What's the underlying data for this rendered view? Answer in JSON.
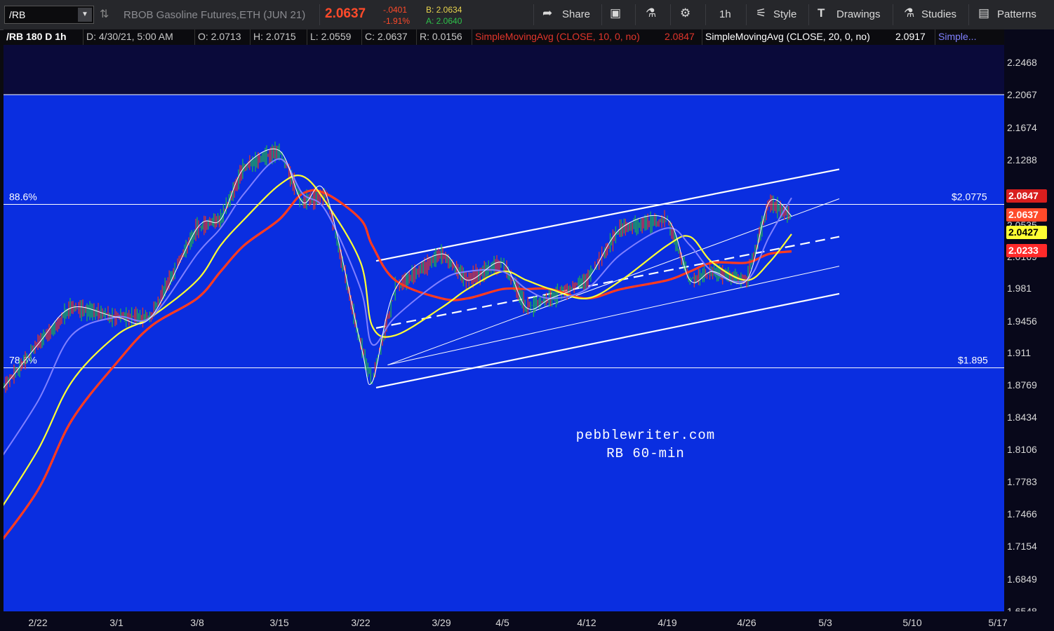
{
  "toolbar": {
    "symbol": "/RB",
    "description": "RBOB Gasoline Futures,ETH (JUN 21)",
    "last": "2.0637",
    "net_change": "-.0401",
    "pct_change": "-1.91%",
    "bid": "B: 2.0634",
    "ask": "A: 2.0640",
    "share_label": "Share",
    "timeframe_label": "1h",
    "style_label": "Style",
    "drawings_label": "Drawings",
    "studies_label": "Studies",
    "patterns_label": "Patterns"
  },
  "info": {
    "symbol": "/RB 180 D 1h",
    "date": "D: 4/30/21, 5:00 AM",
    "open": "O: 2.0713",
    "high": "H: 2.0715",
    "low": "L: 2.0559",
    "close": "C: 2.0637",
    "range": "R: 0.0156",
    "sma10_label": "SimpleMovingAvg (CLOSE, 10, 0, no)",
    "sma10_value": "2.0847",
    "sma20_label": "SimpleMovingAvg (CLOSE, 20, 0, no)",
    "sma20_value": "2.0917",
    "sma_more": "Simple..."
  },
  "annotations": {
    "fib_high": "88.6%",
    "fib_high_price": "$2.0775",
    "fib_low": "78.6%",
    "fib_low_price": "$1.895",
    "watermark1": "pebblewriter.com",
    "watermark2": "RB 60-min"
  },
  "colors": {
    "background": "#0a2ee0",
    "price_up": "#22b14c",
    "price_down": "#e0352b",
    "sma10": "#8080ff",
    "sma20": "#ffff33",
    "sma50": "#ff3b1f",
    "close_line": "#ffffff"
  },
  "chart_data": {
    "type": "line",
    "title": "",
    "xlabel": "",
    "ylabel": "",
    "ylim": [
      1.6548,
      2.2879
    ],
    "y_ticks": [
      "2.2468",
      "2.2067",
      "2.1674",
      "2.1288",
      "2.0909",
      "2.0535",
      "2.0169",
      "1.981",
      "1.9456",
      "1.911",
      "1.8769",
      "1.8434",
      "1.8106",
      "1.7783",
      "1.7466",
      "1.7154",
      "1.6849",
      "1.6548"
    ],
    "x_ticks": [
      "2/22",
      "3/1",
      "3/8",
      "3/15",
      "3/22",
      "3/29",
      "4/5",
      "4/12",
      "4/19",
      "4/26",
      "5/3",
      "5/10",
      "5/17"
    ],
    "price_tags": [
      {
        "value": "2.0847",
        "color": "#d81e1e",
        "text_color": "#ffffff"
      },
      {
        "value": "2.0637",
        "color": "#ff4a2a",
        "text_color": "#ffffff"
      },
      {
        "value": "2.0427",
        "color": "#ffff33",
        "text_color": "#000000"
      },
      {
        "value": "2.0233",
        "color": "#ff2a2a",
        "text_color": "#ffffff"
      }
    ],
    "x": [
      "2/18",
      "2/22",
      "2/25",
      "3/1",
      "3/4",
      "3/8",
      "3/10",
      "3/12",
      "3/15",
      "3/17",
      "3/19",
      "3/22",
      "3/23",
      "3/25",
      "3/29",
      "4/1",
      "4/5",
      "4/7",
      "4/9",
      "4/12",
      "4/15",
      "4/19",
      "4/21",
      "4/23",
      "4/26",
      "4/28",
      "4/30"
    ],
    "series": [
      {
        "values": [
          1.86,
          1.92,
          1.96,
          1.95,
          1.95,
          2.05,
          2.06,
          2.12,
          2.14,
          2.08,
          2.09,
          1.92,
          1.88,
          1.98,
          2.02,
          1.99,
          2.01,
          1.96,
          1.97,
          1.99,
          2.05,
          2.06,
          1.99,
          2.0,
          1.99,
          2.08,
          2.064
        ]
      },
      {
        "values": [
          1.79,
          1.86,
          1.93,
          1.95,
          1.95,
          2.02,
          2.05,
          2.09,
          2.13,
          2.09,
          2.07,
          1.98,
          1.92,
          1.95,
          1.99,
          2.0,
          2.0,
          1.98,
          1.97,
          1.98,
          2.02,
          2.05,
          2.03,
          2.0,
          1.99,
          2.04,
          2.085
        ]
      },
      {
        "values": [
          1.74,
          1.81,
          1.88,
          1.93,
          1.95,
          1.99,
          2.03,
          2.06,
          2.1,
          2.11,
          2.08,
          2.01,
          1.94,
          1.93,
          1.96,
          1.98,
          2.0,
          1.99,
          1.98,
          1.97,
          1.99,
          2.03,
          2.04,
          2.01,
          1.99,
          2.01,
          2.043
        ]
      },
      {
        "values": [
          1.71,
          1.77,
          1.84,
          1.9,
          1.94,
          1.97,
          2.0,
          2.03,
          2.06,
          2.09,
          2.09,
          2.06,
          2.03,
          1.99,
          1.97,
          1.97,
          1.98,
          1.98,
          1.98,
          1.97,
          1.98,
          1.99,
          2.0,
          2.01,
          2.01,
          2.02,
          2.023
        ]
      }
    ],
    "trend_lines": [
      {
        "from": [
          "3/22",
          2.012
        ],
        "to": [
          "5/3",
          2.118
        ]
      },
      {
        "from": [
          "3/23",
          1.898
        ],
        "to": [
          "5/3",
          2.084
        ]
      },
      {
        "from": [
          "3/22",
          1.938
        ],
        "to": [
          "5/3",
          2.04
        ]
      },
      {
        "from": [
          "3/23",
          1.898
        ],
        "to": [
          "5/3",
          2.006
        ]
      },
      {
        "from": [
          "3/22",
          1.874
        ],
        "to": [
          "5/3",
          1.975
        ]
      }
    ],
    "h_lines": [
      2.0775,
      1.895
    ],
    "shaded_above": 2.2067,
    "grid": false,
    "legend": "none"
  }
}
